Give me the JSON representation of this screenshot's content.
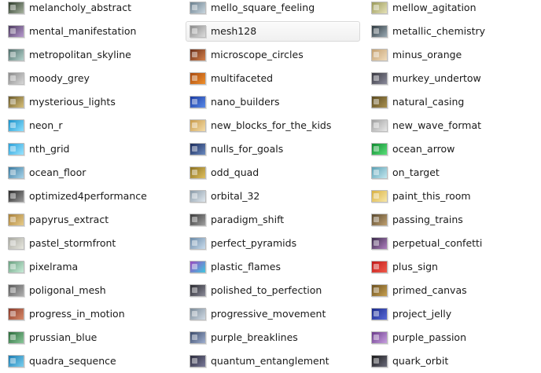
{
  "selected_item": "mesh128",
  "items": [
    {
      "label": "melancholy_abstract",
      "icon": "preset-thumbnail-icon",
      "colors": [
        "#2d3a2a",
        "#a8b4a0"
      ]
    },
    {
      "label": "mello_square_feeling",
      "icon": "preset-thumbnail-icon",
      "colors": [
        "#6a7f8e",
        "#c9d6de"
      ]
    },
    {
      "label": "mellow_agitation",
      "icon": "preset-thumbnail-icon",
      "colors": [
        "#9a9a5a",
        "#e6e2b8"
      ]
    },
    {
      "label": "mental_manifestation",
      "icon": "preset-thumbnail-icon",
      "colors": [
        "#4b3a5e",
        "#b89ad0"
      ]
    },
    {
      "label": "mesh128",
      "icon": "preset-thumbnail-icon",
      "colors": [
        "#8a8a8a",
        "#dcdcdc"
      ]
    },
    {
      "label": "metallic_chemistry",
      "icon": "preset-thumbnail-icon",
      "colors": [
        "#2f3a40",
        "#9aaab4"
      ]
    },
    {
      "label": "metropolitan_skyline",
      "icon": "preset-thumbnail-icon",
      "colors": [
        "#4f6e6a",
        "#b4d2cc"
      ]
    },
    {
      "label": "microscope_circles",
      "icon": "preset-thumbnail-icon",
      "colors": [
        "#6a2f1a",
        "#d4804a"
      ]
    },
    {
      "label": "minus_orange",
      "icon": "preset-thumbnail-icon",
      "colors": [
        "#c4a070",
        "#f0dcbc"
      ]
    },
    {
      "label": "moody_grey",
      "icon": "preset-thumbnail-icon",
      "colors": [
        "#8a8a8a",
        "#d8d8d8"
      ]
    },
    {
      "label": "multifaceted",
      "icon": "preset-thumbnail-icon",
      "colors": [
        "#a84a10",
        "#f0902c"
      ]
    },
    {
      "label": "murkey_undertow",
      "icon": "preset-thumbnail-icon",
      "colors": [
        "#3a3a42",
        "#8a8a9a"
      ]
    },
    {
      "label": "mysterious_lights",
      "icon": "preset-thumbnail-icon",
      "colors": [
        "#6a5a2a",
        "#d8c07a"
      ]
    },
    {
      "label": "nano_builders",
      "icon": "preset-thumbnail-icon",
      "colors": [
        "#1a3aa0",
        "#5a8ae8"
      ]
    },
    {
      "label": "natural_casing",
      "icon": "preset-thumbnail-icon",
      "colors": [
        "#5a4a20",
        "#a89050"
      ]
    },
    {
      "label": "neon_r",
      "icon": "preset-thumbnail-icon",
      "colors": [
        "#1a90c8",
        "#8ae0ff"
      ]
    },
    {
      "label": "new_blocks_for_the_kids",
      "icon": "preset-thumbnail-icon",
      "colors": [
        "#c89a4a",
        "#f4dca8"
      ]
    },
    {
      "label": "new_wave_format",
      "icon": "preset-thumbnail-icon",
      "colors": [
        "#a0a0a0",
        "#e8e8e8"
      ]
    },
    {
      "label": "nth_grid",
      "icon": "preset-thumbnail-icon",
      "colors": [
        "#2aa0d8",
        "#9ae4ff"
      ]
    },
    {
      "label": "nulls_for_goals",
      "icon": "preset-thumbnail-icon",
      "colors": [
        "#1a2a5a",
        "#6a8ac0"
      ]
    },
    {
      "label": "ocean_arrow",
      "icon": "preset-thumbnail-icon",
      "colors": [
        "#108a30",
        "#5ae07a"
      ]
    },
    {
      "label": "ocean_floor",
      "icon": "preset-thumbnail-icon",
      "colors": [
        "#3a7aa0",
        "#a8d4ea"
      ]
    },
    {
      "label": "odd_quad",
      "icon": "preset-thumbnail-icon",
      "colors": [
        "#8a7020",
        "#e0c060"
      ]
    },
    {
      "label": "on_target",
      "icon": "preset-thumbnail-icon",
      "colors": [
        "#5aa0b4",
        "#c4e8f0"
      ]
    },
    {
      "label": "optimized4performance",
      "icon": "preset-thumbnail-icon",
      "colors": [
        "#2a2a2a",
        "#9a9a9a"
      ]
    },
    {
      "label": "orbital_32",
      "icon": "preset-thumbnail-icon",
      "colors": [
        "#8a9aa8",
        "#e0e8ee"
      ]
    },
    {
      "label": "paint_this_room",
      "icon": "preset-thumbnail-icon",
      "colors": [
        "#d8b040",
        "#f8e8a8"
      ]
    },
    {
      "label": "papyrus_extract",
      "icon": "preset-thumbnail-icon",
      "colors": [
        "#a8803a",
        "#e8cc8a"
      ]
    },
    {
      "label": "paradigm_shift",
      "icon": "preset-thumbnail-icon",
      "colors": [
        "#3a3a3a",
        "#a0a0a0"
      ]
    },
    {
      "label": "passing_trains",
      "icon": "preset-thumbnail-icon",
      "colors": [
        "#5a4a30",
        "#c0a070"
      ]
    },
    {
      "label": "pastel_stormfront",
      "icon": "preset-thumbnail-icon",
      "colors": [
        "#a8a8a0",
        "#e8e8e0"
      ]
    },
    {
      "label": "perfect_pyramids",
      "icon": "preset-thumbnail-icon",
      "colors": [
        "#6a8aa8",
        "#cadcec"
      ]
    },
    {
      "label": "perpetual_confetti",
      "icon": "preset-thumbnail-icon",
      "colors": [
        "#3a2a4a",
        "#b080c0"
      ]
    },
    {
      "label": "pixelrama",
      "icon": "preset-thumbnail-icon",
      "colors": [
        "#6aa080",
        "#c8ecd8"
      ]
    },
    {
      "label": "plastic_flames",
      "icon": "preset-thumbnail-icon",
      "colors": [
        "#9a4ac0",
        "#40c8e0"
      ]
    },
    {
      "label": "plus_sign",
      "icon": "preset-thumbnail-icon",
      "colors": [
        "#c01a1a",
        "#f05a4a"
      ]
    },
    {
      "label": "poligonal_mesh",
      "icon": "preset-thumbnail-icon",
      "colors": [
        "#5a5a5a",
        "#b0b0b0"
      ]
    },
    {
      "label": "polished_to_perfection",
      "icon": "preset-thumbnail-icon",
      "colors": [
        "#2a2a30",
        "#8a8a98"
      ]
    },
    {
      "label": "primed_canvas",
      "icon": "preset-thumbnail-icon",
      "colors": [
        "#6a5020",
        "#c8a050"
      ]
    },
    {
      "label": "progress_in_motion",
      "icon": "preset-thumbnail-icon",
      "colors": [
        "#8a3a2a",
        "#d88a6a"
      ]
    },
    {
      "label": "progressive_movement",
      "icon": "preset-thumbnail-icon",
      "colors": [
        "#7a8a98",
        "#d0dae4"
      ]
    },
    {
      "label": "project_jelly",
      "icon": "preset-thumbnail-icon",
      "colors": [
        "#1a2a8a",
        "#5a6ad8"
      ]
    },
    {
      "label": "prussian_blue",
      "icon": "preset-thumbnail-icon",
      "colors": [
        "#2a6a3a",
        "#8ac89a"
      ]
    },
    {
      "label": "purple_breaklines",
      "icon": "preset-thumbnail-icon",
      "colors": [
        "#3a4a6a",
        "#a0b0d0"
      ]
    },
    {
      "label": "purple_passion",
      "icon": "preset-thumbnail-icon",
      "colors": [
        "#6a3a8a",
        "#c8a0e0"
      ]
    },
    {
      "label": "quadra_sequence",
      "icon": "preset-thumbnail-icon",
      "colors": [
        "#1a7ab0",
        "#7ad0f0"
      ]
    },
    {
      "label": "quantum_entanglement",
      "icon": "preset-thumbnail-icon",
      "colors": [
        "#2a2a3a",
        "#7a7a9a"
      ]
    },
    {
      "label": "quark_orbit",
      "icon": "preset-thumbnail-icon",
      "colors": [
        "#1a1a1a",
        "#6a6a7a"
      ]
    }
  ]
}
